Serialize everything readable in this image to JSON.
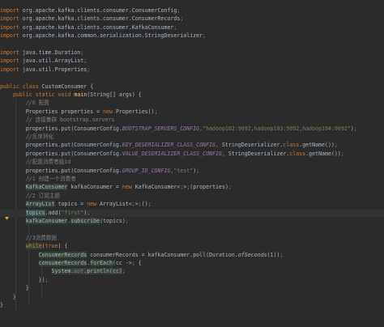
{
  "code_lines": [
    "import org.apache.kafka.clients.consumer.ConsumerConfig;",
    "import org.apache.kafka.clients.consumer.ConsumerRecords;",
    "import org.apache.kafka.clients.consumer.KafkaConsumer;",
    "import org.apache.kafka.common.serialization.StringDeserializer;",
    "",
    "import java.time.Duration;",
    "import java.util.ArrayList;",
    "import java.util.Properties;",
    "",
    "public class CustomConsumer {",
    "    public static void main(String[] args) {",
    "        //0 配置",
    "        Properties properties = new Properties();",
    "        // 连接集群 bootstrap.servers",
    "        properties.put(ConsumerConfig.BOOTSTRAP_SERVERS_CONFIG,\"hadoop102:9092,hadoop103:9092,hadoop104:9092\");",
    "        //反序列化",
    "        properties.put(ConsumerConfig.KEY_DESERIALIZER_CLASS_CONFIG, StringDeserializer.class.getName());",
    "        properties.put(ConsumerConfig.VALUE_DESERIALIZER_CLASS_CONFIG, StringDeserializer.class.getName());",
    "        //配置消费者组id",
    "        properties.put(ConsumerConfig.GROUP_ID_CONFIG,\"test\");",
    "        //1 创建一个消费者",
    "        KafkaConsumer kafkaConsumer = new KafkaConsumer<>(properties);",
    "        //2 订阅主题",
    "        ArrayList topics = new ArrayList<>();",
    "        topics.add(\"first\");",
    "        kafkaConsumer.subscribe(topics);",
    "",
    "        //3消费数据",
    "        while(true) {",
    "            ConsumerRecords consumerRecords = kafkaConsumer.poll(Duration.ofSeconds(1));",
    "            consumerRecords.forEach(cc -> {",
    "                System.out.println(cc);",
    "            });",
    "        }",
    "    }",
    "}"
  ],
  "colors": {
    "background": "#2b2b2b",
    "keyword": "#cc7832",
    "comment": "#808080",
    "string": "#6a8759",
    "constant": "#9876aa",
    "method": "#ffc66d",
    "text": "#a9b7c6"
  },
  "gutter_icons": [
    "lightbulb-icon"
  ]
}
